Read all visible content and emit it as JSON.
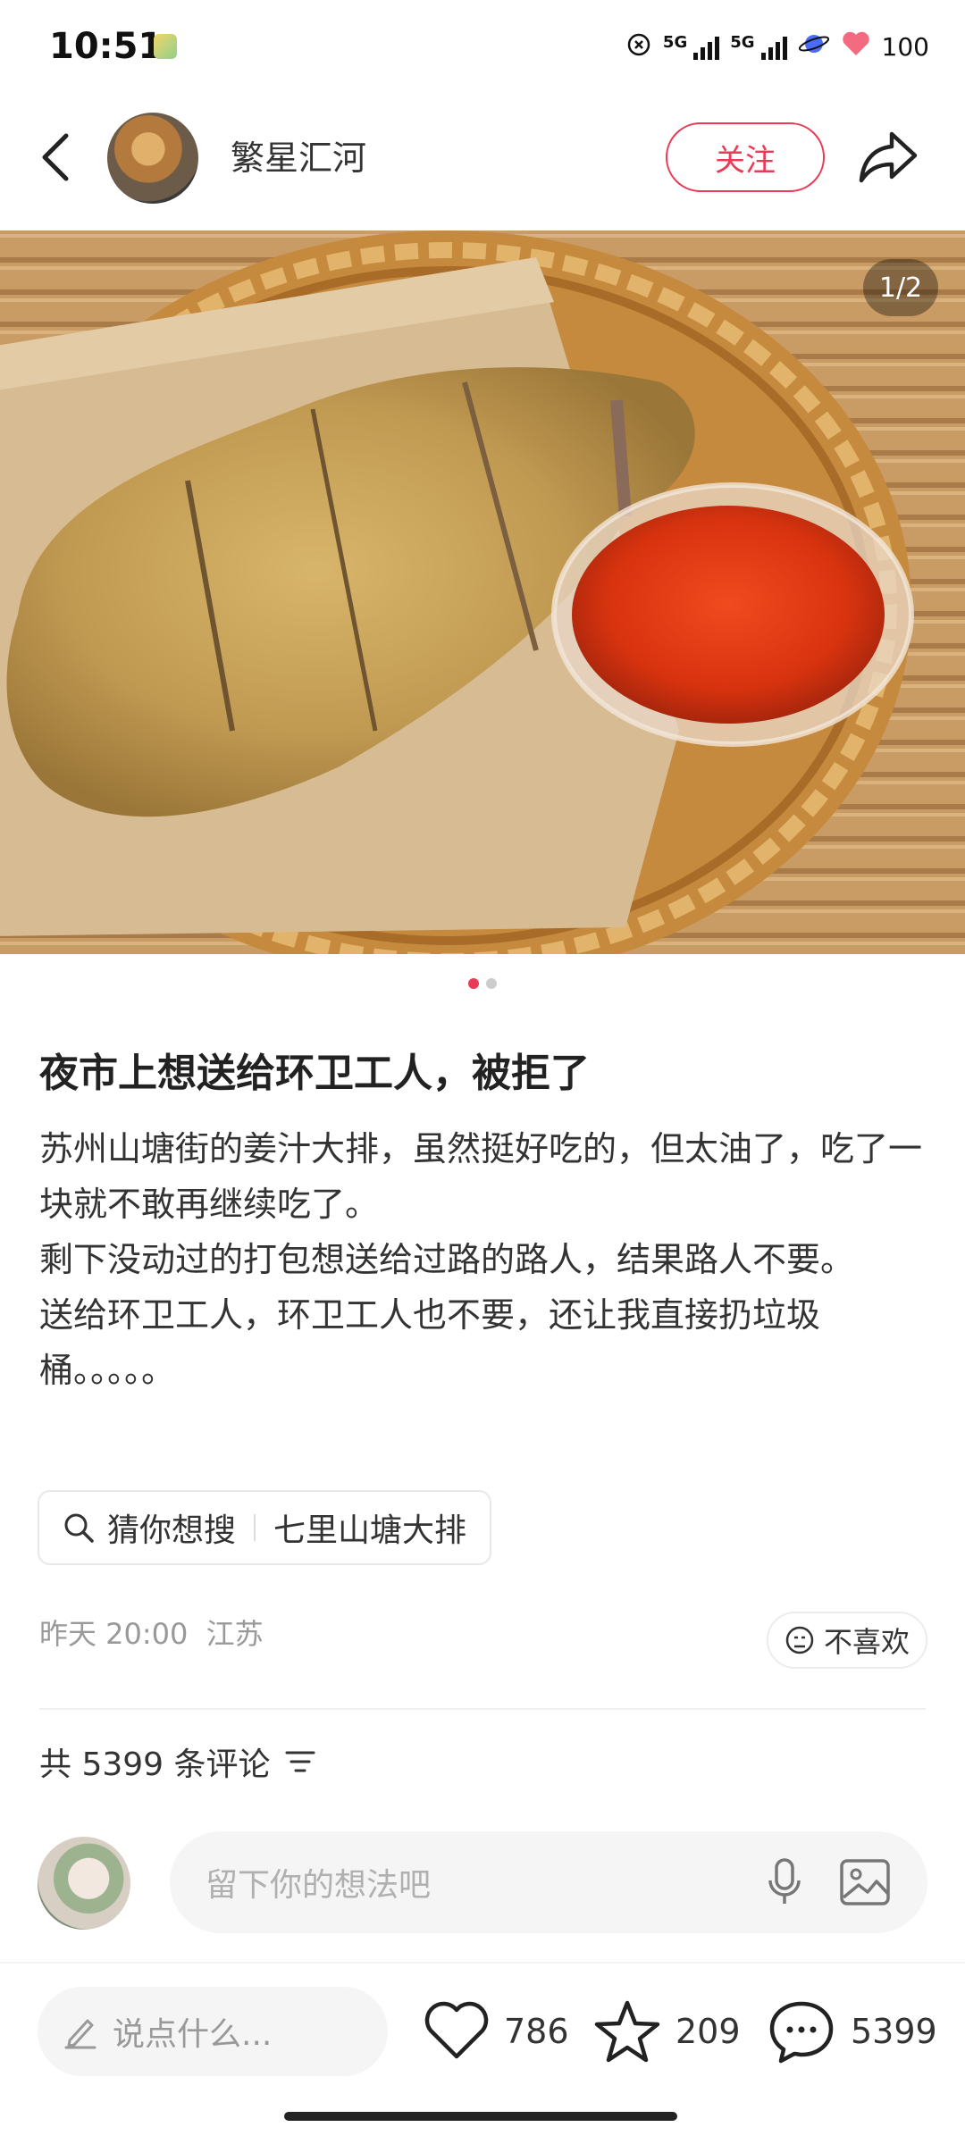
{
  "status_bar": {
    "time": "10:51",
    "network1": "5G",
    "network2": "5G",
    "battery": "100"
  },
  "header": {
    "author_name": "繁星汇河",
    "follow_label": "关注"
  },
  "media": {
    "page_counter": "1/2",
    "total_pages": 2,
    "current_page": 1
  },
  "post": {
    "title": "夜市上想送给环卫工人，被拒了",
    "body": [
      "苏州山塘街的姜汁大排，虽然挺好吃的，但太油了，吃了一块就不敢再继续吃了。",
      "剩下没动过的打包想送给过路的路人，结果路人不要。",
      "送给环卫工人，环卫工人也不要，还让我直接扔垃圾桶。。。。。"
    ],
    "search_prefix": "猜你想搜",
    "search_term": "七里山塘大排",
    "date": "昨天 20:00",
    "location": "江苏",
    "dislike_label": "不喜欢"
  },
  "comments": {
    "count_label": "共 5399 条评论",
    "input_placeholder": "留下你的想法吧"
  },
  "bottom_bar": {
    "say_placeholder": "说点什么...",
    "likes": "786",
    "collects": "209",
    "comments": "5399"
  },
  "colors": {
    "accent": "#ea3a55"
  }
}
